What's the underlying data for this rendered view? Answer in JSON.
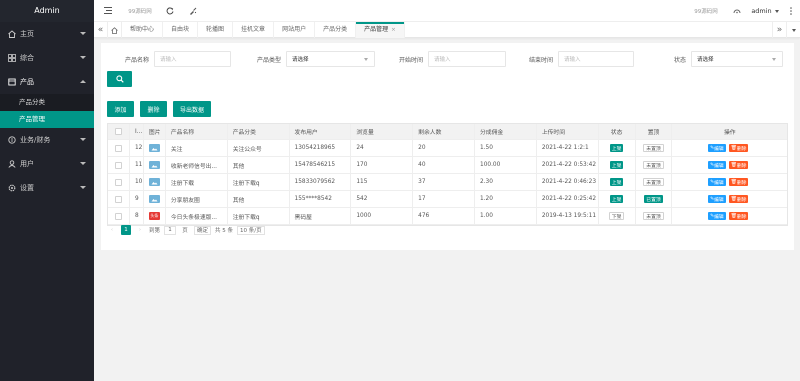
{
  "app": {
    "title": "Admin"
  },
  "sidebar": {
    "items": [
      {
        "label": "主页",
        "icon": "home-icon"
      },
      {
        "label": "综合",
        "icon": "grid-icon"
      },
      {
        "label": "产品",
        "icon": "product-icon",
        "open": true,
        "children": [
          {
            "label": "产品分类"
          },
          {
            "label": "产品管理",
            "active": true
          }
        ]
      },
      {
        "label": "业务/财务",
        "icon": "finance-icon"
      },
      {
        "label": "用户",
        "icon": "user-icon"
      },
      {
        "label": "设置",
        "icon": "settings-icon"
      }
    ]
  },
  "header": {
    "site_link": "99源码网",
    "right_link": "99源码网",
    "user": "admin"
  },
  "tabs": [
    "帮助中心",
    "自由块",
    "轮播图",
    "挂机文章",
    "网站用户",
    "产品分类",
    "产品管理"
  ],
  "filters": {
    "name": {
      "label": "产品名称",
      "placeholder": "请输入"
    },
    "type": {
      "label": "产品类型",
      "value": "请选择"
    },
    "start": {
      "label": "开始时间",
      "placeholder": "请输入"
    },
    "end": {
      "label": "结束时间",
      "placeholder": "请输入"
    },
    "status": {
      "label": "状态",
      "value": "请选择"
    }
  },
  "actions": {
    "add": "添加",
    "delete": "删除",
    "export": "导出数据"
  },
  "table": {
    "headers": [
      "I...",
      "图片",
      "产品名称",
      "产品分类",
      "发布用户",
      "浏览量",
      "剩余人数",
      "分成佣金",
      "上传时间",
      "状态",
      "置顶",
      "操作"
    ],
    "rows": [
      {
        "id": "12",
        "img": "blue",
        "name": "关注",
        "category": "关注公众号",
        "user": "13054218965",
        "views": "24",
        "remain": "20",
        "commission": "1.50",
        "time": "2021-4-22 1:2:1",
        "status": "上架",
        "status_on": true,
        "top": "未置顶",
        "top_on": false
      },
      {
        "id": "11",
        "img": "blue",
        "name": "收新老师信号出...",
        "category": "其他",
        "user": "15478546215",
        "views": "170",
        "remain": "40",
        "commission": "100.00",
        "time": "2021-4-22 0:53:42",
        "status": "上架",
        "status_on": true,
        "top": "未置顶",
        "top_on": false
      },
      {
        "id": "10",
        "img": "blue",
        "name": "注册下载",
        "category": "注册下载q",
        "user": "15833079562",
        "views": "115",
        "remain": "37",
        "commission": "2.30",
        "time": "2021-4-22 0:46:23",
        "status": "上架",
        "status_on": true,
        "top": "未置顶",
        "top_on": false
      },
      {
        "id": "9",
        "img": "blue",
        "name": "分享朋友圈",
        "category": "其他",
        "user": "155****8542",
        "views": "542",
        "remain": "17",
        "commission": "1.20",
        "time": "2021-4-22 0:25:42",
        "status": "上架",
        "status_on": true,
        "top": "已置顶",
        "top_on": true
      },
      {
        "id": "8",
        "img": "red",
        "name": "今日头条极速版...",
        "category": "注册下载q",
        "user": "黑码屋",
        "views": "1000",
        "remain": "476",
        "commission": "1.00",
        "time": "2019-4-13 19:5:11",
        "status": "下架",
        "status_on": false,
        "top": "未置顶",
        "top_on": false
      }
    ],
    "edit_label": "编辑",
    "delete_label": "删除"
  },
  "pager": {
    "current": "1",
    "goto_label": "到第",
    "page_input": "1",
    "page_unit": "页",
    "confirm": "确定",
    "total": "共 5 条",
    "per_page": "10 条/页"
  },
  "colors": {
    "primary": "#009688",
    "sidebar": "#20222a",
    "edit": "#1e9fff",
    "delete": "#ff5722"
  }
}
